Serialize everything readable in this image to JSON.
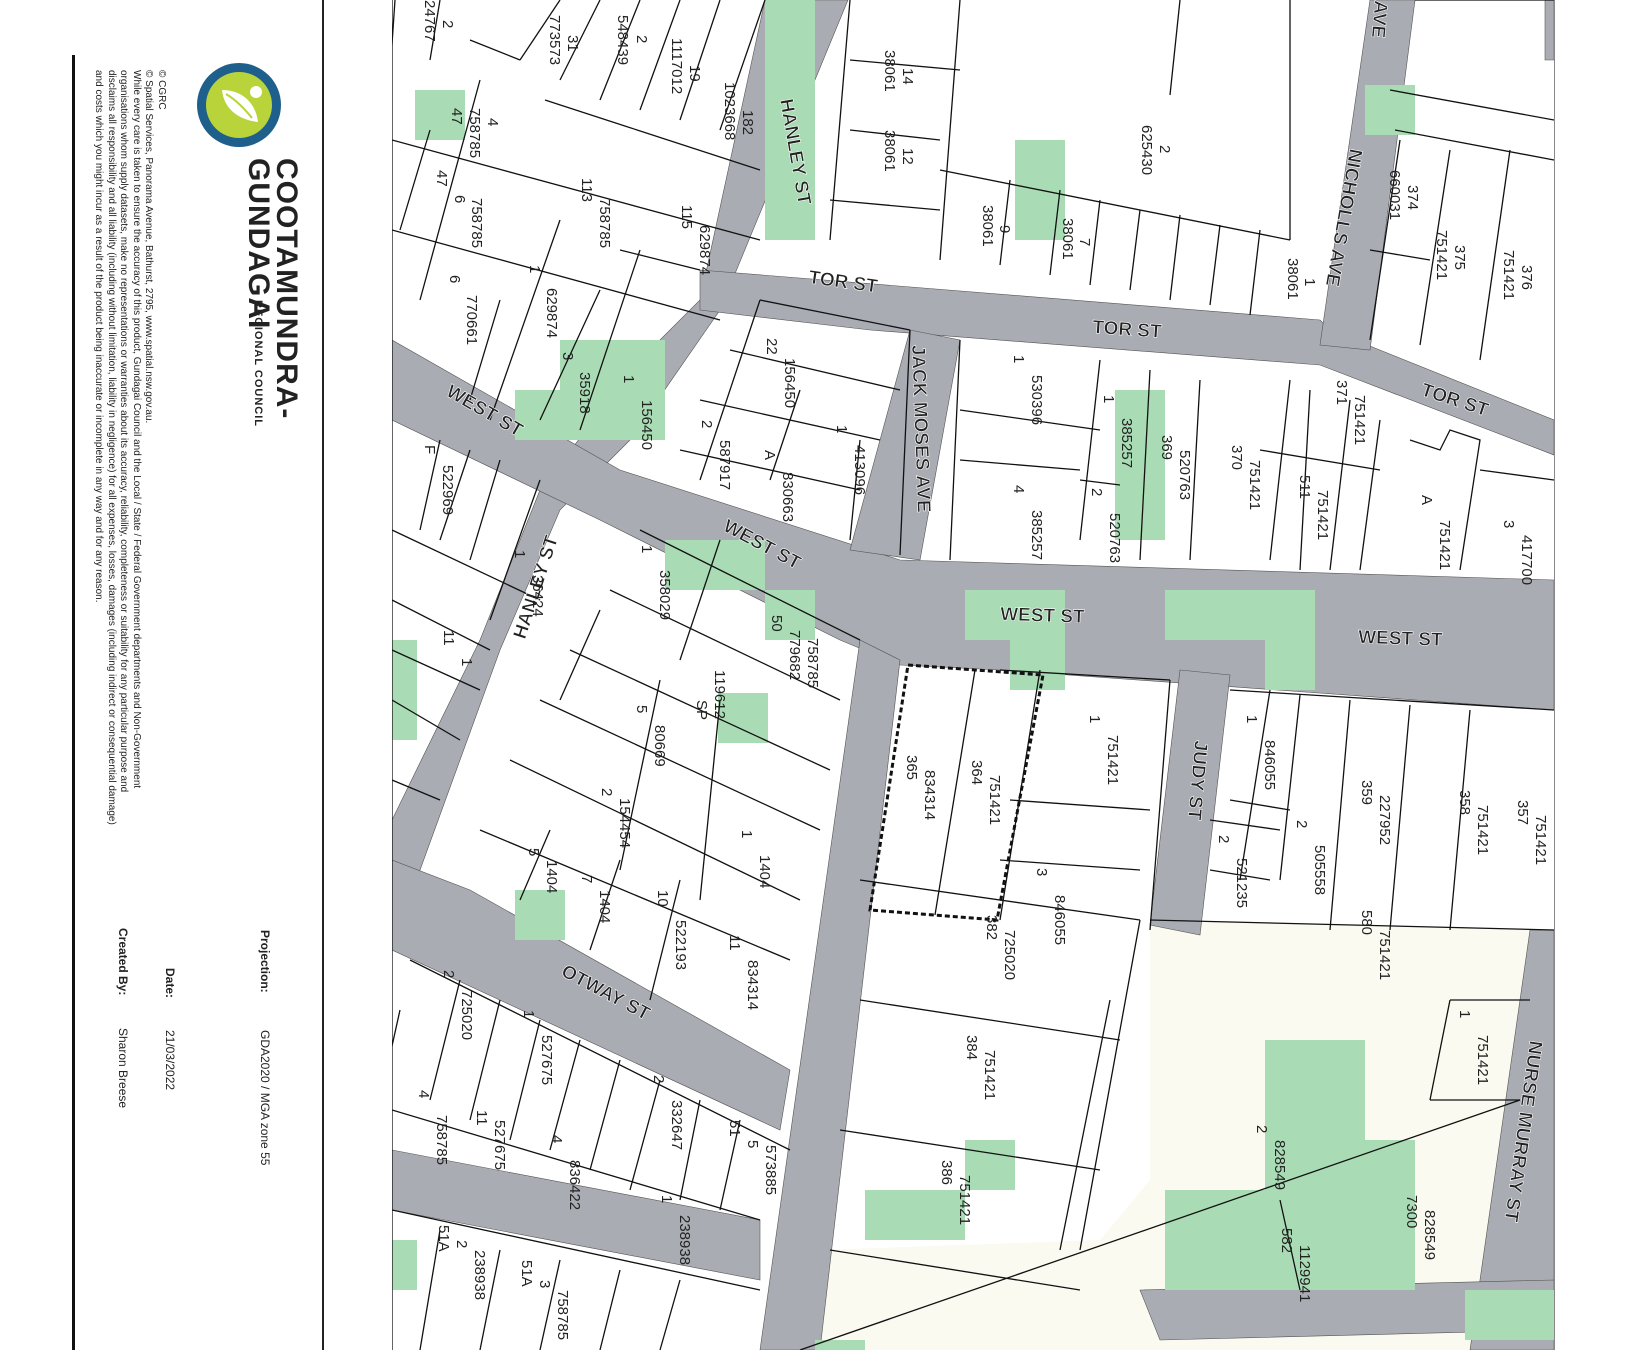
{
  "header": {
    "council_name": "COOTAMUNDRA-",
    "council_name_2": "GUNDAGAI",
    "council_sub": "REGIONAL COUNCIL"
  },
  "disclaimer": {
    "line1": "© CGRC",
    "line2": "© Spatial Services, Panorama Avenue, Bathurst, 2795, www.spatial.nsw.gov.au.",
    "line3": "While every care is taken to ensure the accuracy of this product, Gundagai Council and the Local / State / Federal Government departments and Non-Government organisations whom supply datasets, make no representations or warranties about its accuracy, reliability, completeness or suitability for any particular purpose and disclaims all responsibility and all liability (including without limitation, liability in negligence) for all expenses, losses, damages (including indirect or consequential damage) and costs which you might incur as a result of the product being inaccurate or incomplete in any way and for any reason."
  },
  "meta": {
    "projection_label": "Projection:",
    "projection_value": "GDA2020 / MGA zone 55",
    "date_label": "Date:",
    "date_value": "21/03/2022",
    "created_label": "Created By:",
    "created_value": "Sharon Breese"
  },
  "streets": {
    "hanley_1": "HANLEY ST",
    "hanley_2": "HANLEY ST",
    "tor_1": "TOR ST",
    "tor_2": "TOR ST",
    "tor_3": "TOR ST",
    "jack_moses": "JACK MOSES AVE",
    "nicholls": "NICHOLLS AVE",
    "nicholls_top": "AVE",
    "west_1": "WEST ST",
    "west_2": "WEST ST",
    "west_3": "WEST ST",
    "west_4": "WEST ST",
    "judy": "JUDY ST",
    "otway": "OTWAY ST",
    "nurse_murray": "NURSE MURRAY ST"
  },
  "lots": [
    "2",
    "24767",
    "31",
    "773573",
    "2",
    "548439",
    "19",
    "1117012",
    "182",
    "1023668",
    "14",
    "38061",
    "12",
    "38061",
    "2",
    "625430",
    "9",
    "38061",
    "7",
    "38061",
    "1",
    "38061",
    "374",
    "660031",
    "375",
    "751421",
    "376",
    "751421",
    "4",
    "758785",
    "47",
    "758785",
    "6",
    "47",
    "758785",
    "113",
    "629874",
    "115",
    "629874",
    "1",
    "770661",
    "6",
    "35918",
    "3",
    "156450",
    "1",
    "156450",
    "22",
    "587917",
    "2",
    "830663",
    "A",
    "413096",
    "1",
    "530396",
    "1",
    "385257",
    "4",
    "385257",
    "1",
    "520763",
    "2",
    "520763",
    "369",
    "751421",
    "370",
    "751421",
    "371",
    "751421",
    "511",
    "751421",
    "A",
    "417700",
    "3",
    "522969",
    "F",
    "36424",
    "1",
    "358029",
    "1",
    "779682",
    "50",
    "758785",
    "1",
    "11",
    "119612",
    "SP",
    "80669",
    "5",
    "154454",
    "2",
    "1404",
    "5",
    "1404",
    "7",
    "1404",
    "1",
    "522193",
    "10",
    "834314",
    "11",
    "834314",
    "365",
    "751421",
    "364",
    "751421",
    "1",
    "846055",
    "3",
    "846055",
    "1",
    "521235",
    "2",
    "505558",
    "2",
    "227952",
    "359",
    "751421",
    "358",
    "751421",
    "357",
    "751421",
    "580",
    "725020",
    "382",
    "751421",
    "384",
    "751421",
    "386",
    "751421",
    "1",
    "828549",
    "2",
    "828549",
    "7300",
    "1129941",
    "582",
    "725020",
    "2",
    "527675",
    "1",
    "332647",
    "2",
    "573885",
    "5",
    "51",
    "758785",
    "4",
    "527675",
    "11",
    "836422",
    "4",
    "238938",
    "1",
    "238938",
    "2",
    "51A",
    "758785",
    "3",
    "51A",
    "758785"
  ],
  "colors": {
    "road": "#a9acb2",
    "green": "#a9dcb4",
    "open_space": "#fafaf0",
    "parcel_line": "#111111"
  }
}
